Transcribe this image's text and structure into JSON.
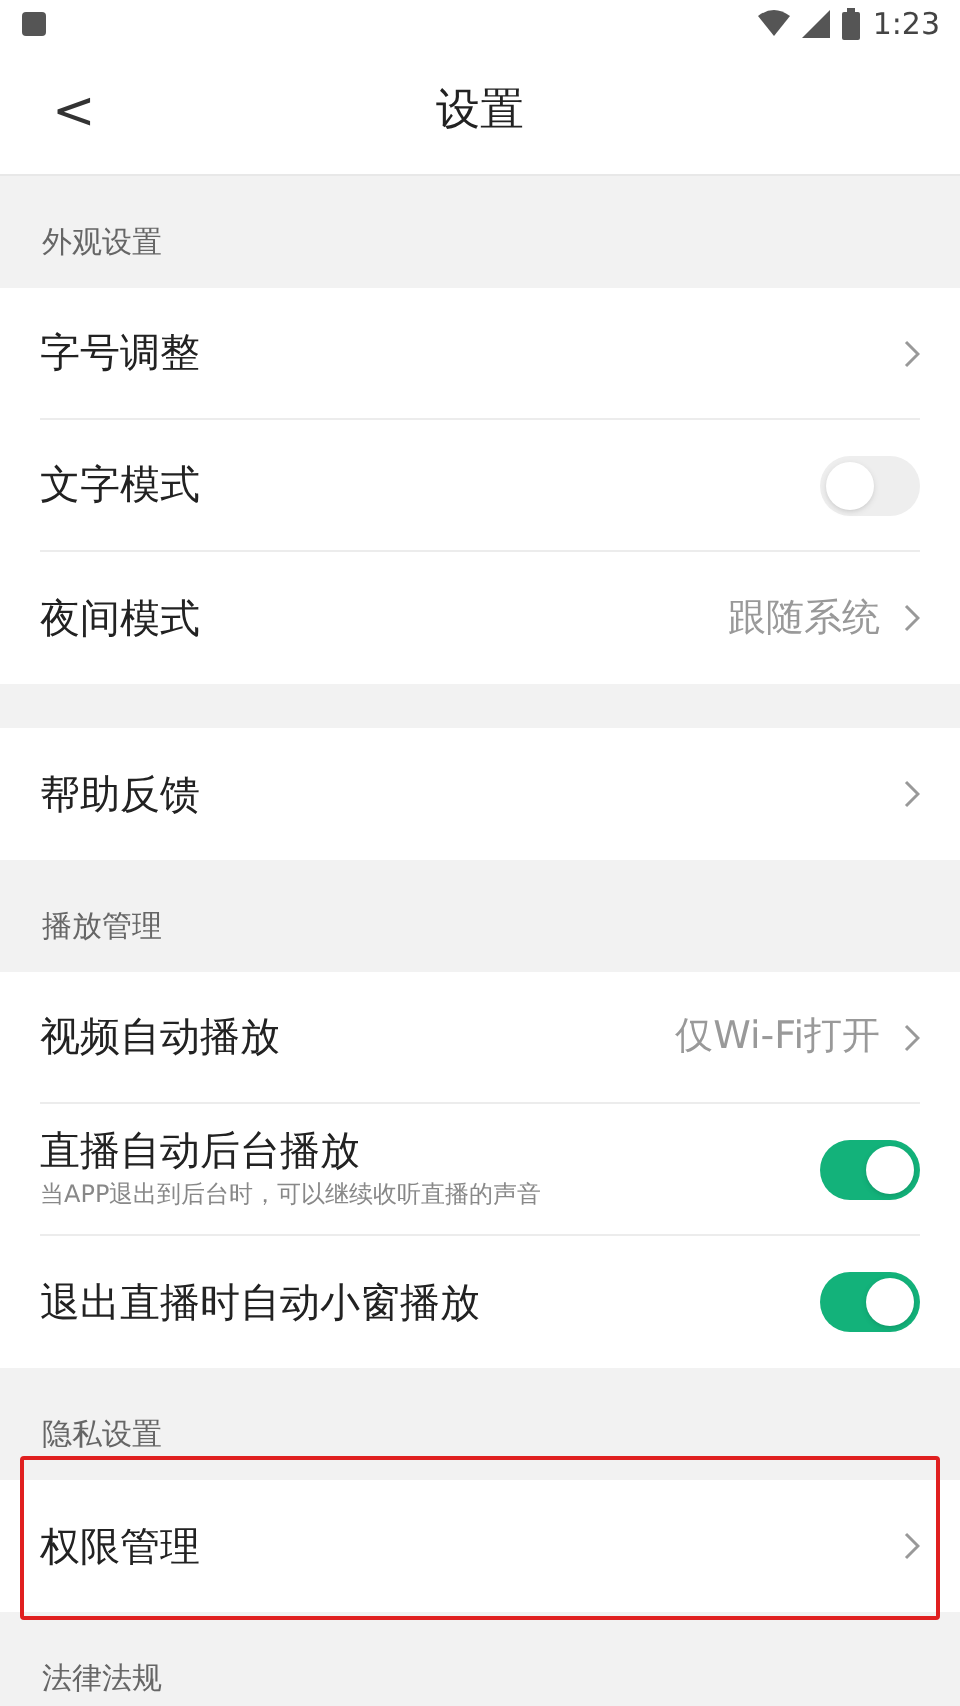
{
  "status_bar": {
    "time": "1:23"
  },
  "header": {
    "back": "<",
    "title": "设置"
  },
  "sections": [
    {
      "title": "外观设置",
      "items": [
        {
          "kind": "link",
          "label": "字号调整",
          "highlighted": false
        },
        {
          "kind": "toggle",
          "label": "文字模式",
          "on": false
        },
        {
          "kind": "link",
          "label": "夜间模式",
          "value": "跟随系统",
          "highlighted": false
        }
      ]
    },
    {
      "items": [
        {
          "kind": "link",
          "label": "帮助反馈",
          "highlighted": false
        }
      ]
    },
    {
      "title": "播放管理",
      "items": [
        {
          "kind": "link",
          "label": "视频自动播放",
          "value": "仅Wi-Fi打开",
          "highlighted": false
        },
        {
          "kind": "toggle",
          "label": "直播自动后台播放",
          "subtitle": "当APP退出到后台时，可以继续收听直播的声音",
          "on": true
        },
        {
          "kind": "toggle",
          "label": "退出直播时自动小窗播放",
          "on": true
        }
      ]
    },
    {
      "title": "隐私设置",
      "items": [
        {
          "kind": "link",
          "label": "权限管理",
          "highlighted": true
        }
      ]
    },
    {
      "title": "法律法规"
    }
  ]
}
